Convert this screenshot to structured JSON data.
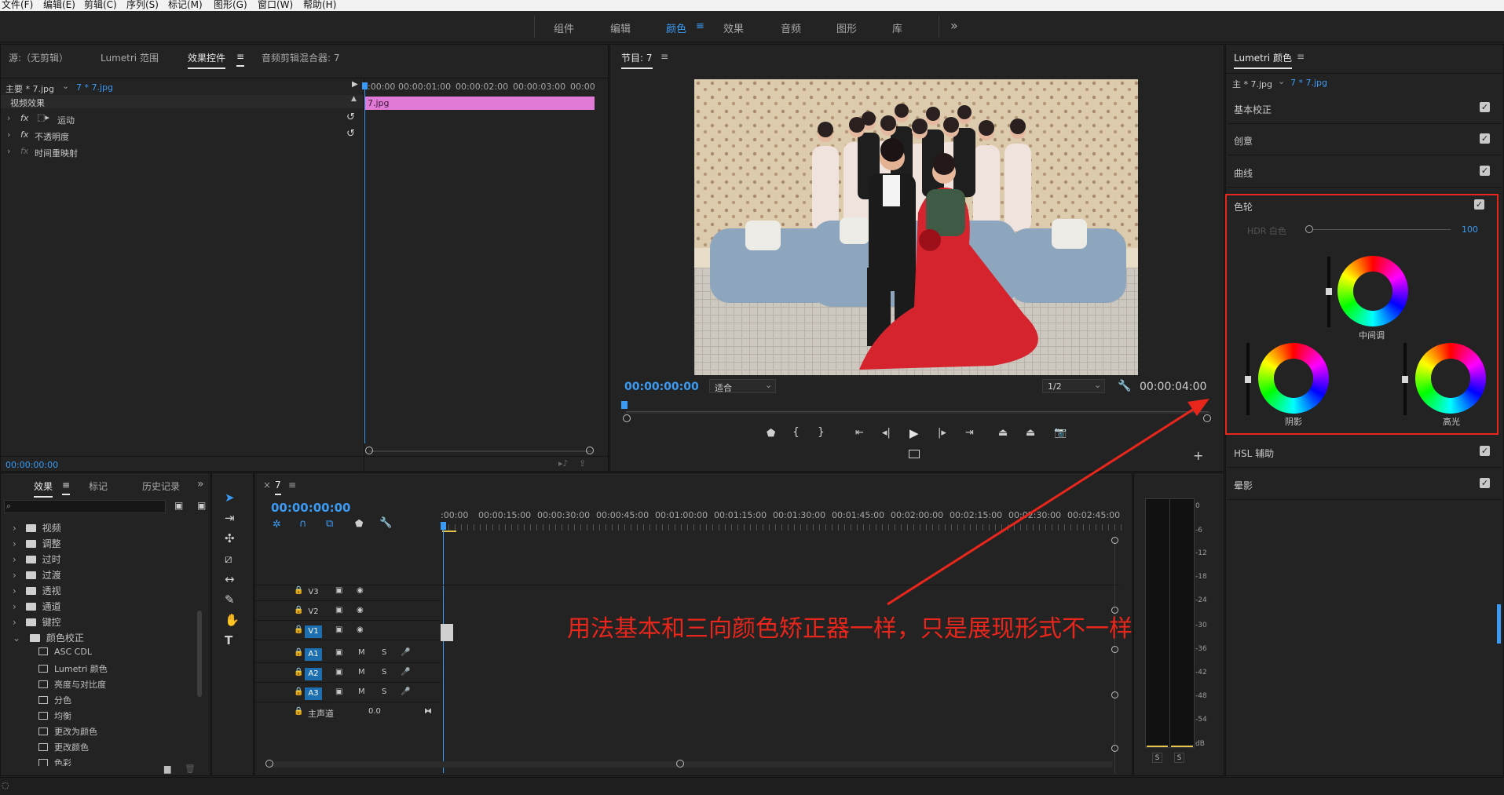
{
  "menu": [
    "文件(F)",
    "编辑(E)",
    "剪辑(C)",
    "序列(S)",
    "标记(M)",
    "图形(G)",
    "窗口(W)",
    "帮助(H)"
  ],
  "workspaces": {
    "tabs": [
      "组件",
      "编辑",
      "颜色",
      "效果",
      "音频",
      "图形",
      "库"
    ],
    "active": "颜色",
    "more": "»"
  },
  "source_panel": {
    "tabs": [
      "源:（无剪辑）",
      "Lumetri 范围",
      "效果控件",
      "音频剪辑混合器: 7"
    ],
    "active_tab": "效果控件",
    "master_label": "主要 * 7.jpg",
    "clip_label": "7 * 7.jpg",
    "section": "视频效果",
    "effects": [
      "运动",
      "不透明度",
      "时间重映射"
    ],
    "timecode": "00:00:00:00",
    "ruler": [
      ":00:00",
      "00:00:01:00",
      "00:00:02:00",
      "00:00:03:00",
      "00:00"
    ],
    "clip_name": "7.jpg"
  },
  "program": {
    "title": "节目: 7",
    "timecode_current": "00:00:00:00",
    "fit": "适合",
    "resolution": "1/2",
    "timecode_duration": "00:00:04:00",
    "image_colors": {
      "wall": "#d8c6a8",
      "floor": "#c9c4bb",
      "sofa": "#8ea6bd",
      "dress": "#d6242e",
      "suit": "#1b1b1b"
    }
  },
  "lumetri": {
    "title": "Lumetri 颜色",
    "master_label": "主 * 7.jpg",
    "clip_label": "7 * 7.jpg",
    "sections": [
      "基本校正",
      "创意",
      "曲线",
      "色轮",
      "HSL 辅助",
      "晕影"
    ],
    "hdr_label": "HDR 白色",
    "hdr_value": "100",
    "hdr_level": 0,
    "wheels": [
      "中间调",
      "阴影",
      "高光"
    ]
  },
  "effects_panel": {
    "tabs": [
      "效果",
      "标记",
      "历史记录"
    ],
    "active_tab": "效果",
    "folders": [
      "视频",
      "调整",
      "过时",
      "过渡",
      "透视",
      "通道",
      "键控",
      "颜色校正"
    ],
    "items": [
      "ASC CDL",
      "Lumetri 颜色",
      "亮度与对比度",
      "分色",
      "均衡",
      "更改为颜色",
      "更改颜色",
      "色彩"
    ]
  },
  "timeline": {
    "tab": "7",
    "timecode": "00:00:00:00",
    "ruler": [
      ":00:00",
      "00:00:15:00",
      "00:00:30:00",
      "00:00:45:00",
      "00:01:00:00",
      "00:01:15:00",
      "00:01:30:00",
      "00:01:45:00",
      "00:02:00:00",
      "00:02:15:00",
      "00:02:30:00",
      "00:02:45:00"
    ],
    "video_tracks": [
      "V3",
      "V2",
      "V1"
    ],
    "audio_tracks": [
      "A1",
      "A2",
      "A3"
    ],
    "master": "主声道",
    "master_value": "0.0"
  },
  "meter": {
    "db": [
      "0",
      "-6",
      "-12",
      "-18",
      "-24",
      "-30",
      "-36",
      "-42",
      "-48",
      "-54",
      "dB"
    ],
    "solo": [
      "S",
      "S"
    ]
  },
  "annotation": {
    "text": "用法基本和三向颜色矫正器一样，只是展现形式不一样",
    "color": "#e8261c"
  }
}
